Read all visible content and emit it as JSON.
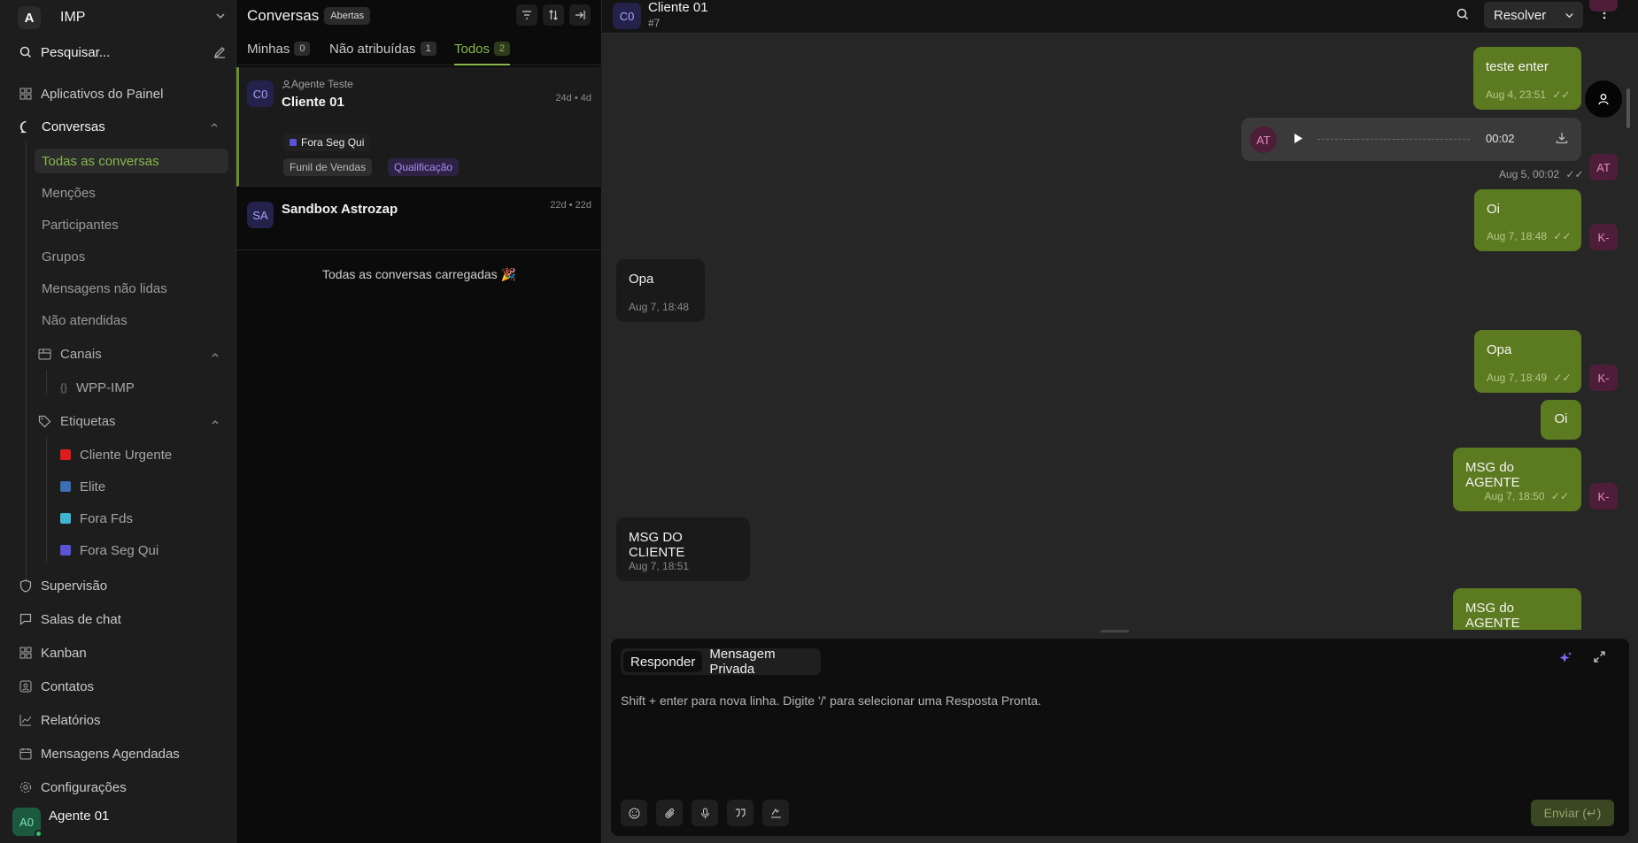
{
  "sidebar": {
    "workspace": "IMP",
    "logo_text": "A",
    "search_placeholder": "Pesquisar...",
    "items": {
      "apps": "Aplicativos do Painel",
      "conversations": "Conversas",
      "supervision": "Supervisão",
      "chat_rooms": "Salas de chat",
      "kanban": "Kanban",
      "contacts": "Contatos",
      "reports": "Relatórios",
      "scheduled": "Mensagens Agendadas",
      "settings": "Configurações"
    },
    "conversation_subitems": [
      "Todas as conversas",
      "Menções",
      "Participantes",
      "Grupos",
      "Mensagens não lidas",
      "Não atendidas"
    ],
    "channels_label": "Canais",
    "channels": [
      "WPP-IMP"
    ],
    "labels_label": "Etiquetas",
    "labels": [
      {
        "name": "Cliente Urgente",
        "color": "#e01b1b"
      },
      {
        "name": "Elite",
        "color": "#3d6fb5"
      },
      {
        "name": "Fora Fds",
        "color": "#3fb5d2"
      },
      {
        "name": "Fora Seg Qui",
        "color": "#5b53d6"
      }
    ],
    "user": {
      "initials": "A0",
      "name": "Agente 01"
    }
  },
  "conv_list": {
    "title": "Conversas",
    "status_badge": "Abertas",
    "tabs": [
      {
        "label": "Minhas",
        "count": "0"
      },
      {
        "label": "Não atribuídas",
        "count": "1"
      },
      {
        "label": "Todos",
        "count": "2"
      }
    ],
    "conversations": [
      {
        "initials": "C0",
        "agent": "Agente Teste",
        "name": "Cliente 01",
        "time": "24d • 4d",
        "label": "Fora Seg Qui",
        "label_color": "#5b53d6",
        "tags": [
          "Funil de Vendas",
          "Qualificação"
        ]
      },
      {
        "initials": "SA",
        "name": "Sandbox Astrozap",
        "time": "22d • 22d"
      }
    ],
    "all_loaded": "Todas as conversas carregadas 🎉"
  },
  "chat": {
    "contact_initials": "C0",
    "contact_name": "Cliente 01",
    "conversation_id": "#7",
    "resolve_label": "Resolver",
    "messages": [
      {
        "text": "teste enter",
        "time": "Aug 4, 23:51",
        "direction": "out"
      },
      {
        "audio_duration": "00:02",
        "time": "Aug 5, 00:02",
        "sender": "AT",
        "direction": "out"
      },
      {
        "text": "Oi",
        "time": "Aug 7, 18:48",
        "sender": "K-",
        "direction": "out"
      },
      {
        "text": "Opa",
        "time": "Aug 7, 18:48",
        "direction": "in"
      },
      {
        "text": "Opa",
        "time": "Aug 7, 18:49",
        "sender": "K-",
        "direction": "out"
      },
      {
        "text": "Oi",
        "direction": "out"
      },
      {
        "text": "MSG do AGENTE",
        "time": "Aug 7, 18:50",
        "sender": "K-",
        "direction": "out"
      },
      {
        "text": "MSG DO CLIENTE",
        "time": "Aug 7, 18:51",
        "direction": "in"
      },
      {
        "text": "MSG do AGENTE",
        "direction": "out"
      }
    ],
    "composer": {
      "tab_reply": "Responder",
      "tab_private": "Mensagem Privada",
      "placeholder": "Shift + enter para nova linha. Digite '/' para selecionar uma Resposta Pronta.",
      "send_label": "Enviar (↵)"
    }
  },
  "colors": {
    "accent": "#86b84a",
    "outgoing_bubble": "#5c7a1f",
    "incoming_bubble": "#1a1a1a"
  }
}
